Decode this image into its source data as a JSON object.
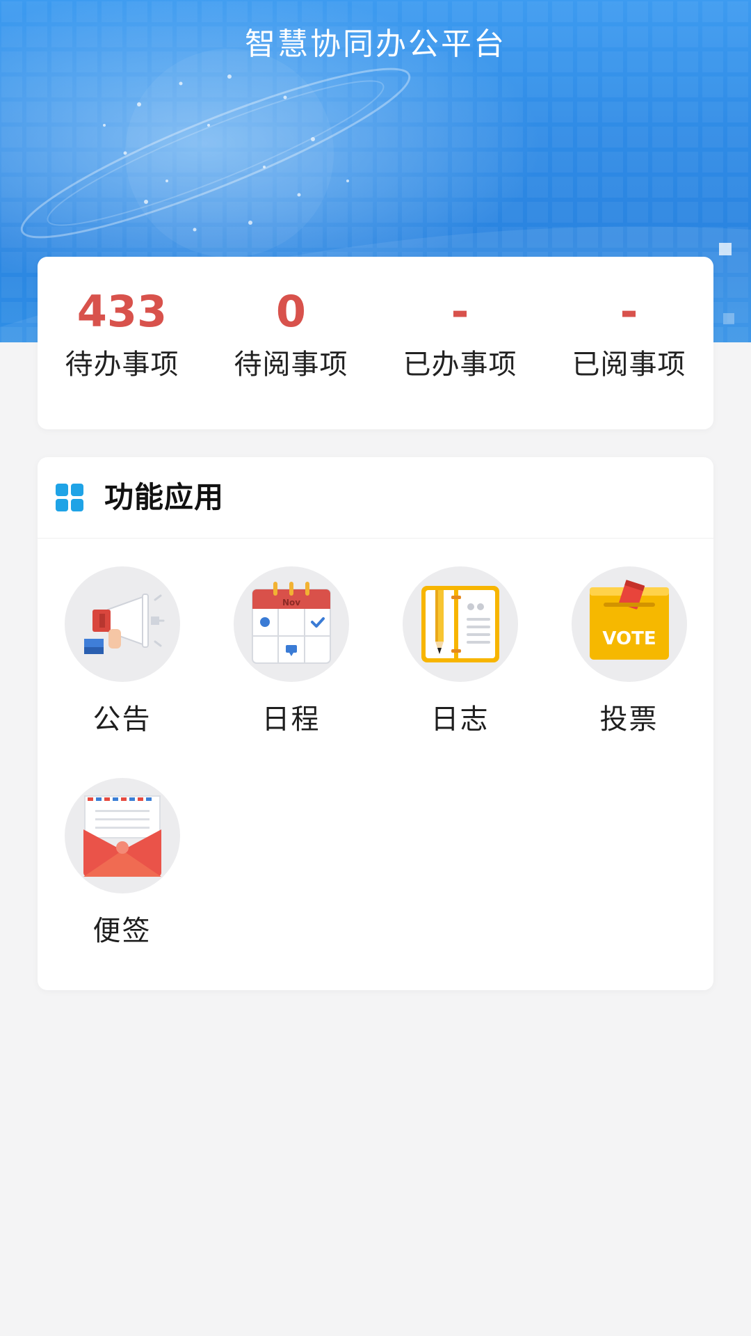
{
  "header": {
    "title": "智慧协同办公平台"
  },
  "stats": [
    {
      "value": "433",
      "label": "待办事项"
    },
    {
      "value": "0",
      "label": "待阅事项"
    },
    {
      "value": "-",
      "label": "已办事项"
    },
    {
      "value": "-",
      "label": "已阅事项"
    }
  ],
  "functions": {
    "title": "功能应用",
    "icon": "grid-icon",
    "apps": [
      {
        "label": "公告",
        "icon": "megaphone-icon"
      },
      {
        "label": "日程",
        "icon": "calendar-icon"
      },
      {
        "label": "日志",
        "icon": "notebook-icon"
      },
      {
        "label": "投票",
        "icon": "ballot-box-icon",
        "icon_text": "VOTE"
      },
      {
        "label": "便签",
        "icon": "envelope-icon"
      }
    ],
    "calendar_month": "Nov"
  },
  "colors": {
    "accent_blue": "#1fa3e6",
    "stat_red": "#d8524c",
    "banner_blue": "#2f8be6"
  }
}
